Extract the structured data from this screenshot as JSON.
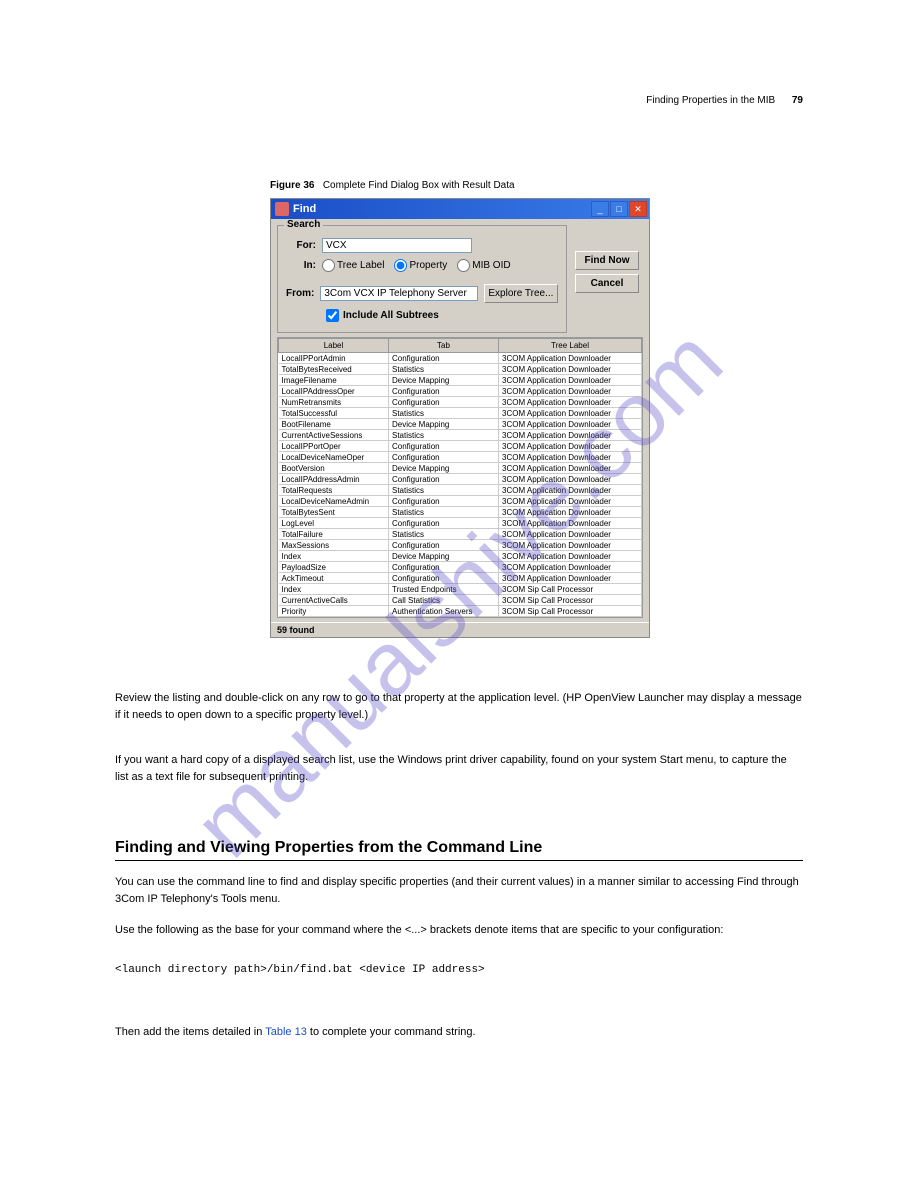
{
  "header": {
    "text": "Finding Properties in the MIB",
    "page": "79"
  },
  "figure": {
    "label": "Figure 36",
    "caption": "Complete Find Dialog Box with Result Data"
  },
  "dialog": {
    "title": "Find",
    "search_legend": "Search",
    "for_label": "For:",
    "for_value": "VCX",
    "in_label": "In:",
    "radio_tree": "Tree Label",
    "radio_property": "Property",
    "radio_miboid": "MIB OID",
    "from_label": "From:",
    "from_value": "3Com VCX IP Telephony Server",
    "explore_button": "Explore Tree...",
    "find_now_button": "Find Now",
    "cancel_button": "Cancel",
    "include_label": "Include All Subtrees",
    "columns": {
      "label": "Label",
      "tab": "Tab",
      "tree": "Tree Label"
    },
    "rows": [
      {
        "label": "LocalIPPortAdmin",
        "tab": "Configuration",
        "tree": "3COM Application Downloader"
      },
      {
        "label": "TotalBytesReceived",
        "tab": "Statistics",
        "tree": "3COM Application Downloader"
      },
      {
        "label": "ImageFilename",
        "tab": "Device Mapping",
        "tree": "3COM Application Downloader"
      },
      {
        "label": "LocalIPAddressOper",
        "tab": "Configuration",
        "tree": "3COM Application Downloader"
      },
      {
        "label": "NumRetransmits",
        "tab": "Configuration",
        "tree": "3COM Application Downloader"
      },
      {
        "label": "TotalSuccessful",
        "tab": "Statistics",
        "tree": "3COM Application Downloader"
      },
      {
        "label": "BootFilename",
        "tab": "Device Mapping",
        "tree": "3COM Application Downloader"
      },
      {
        "label": "CurrentActiveSessions",
        "tab": "Statistics",
        "tree": "3COM Application Downloader"
      },
      {
        "label": "LocalIPPortOper",
        "tab": "Configuration",
        "tree": "3COM Application Downloader"
      },
      {
        "label": "LocalDeviceNameOper",
        "tab": "Configuration",
        "tree": "3COM Application Downloader"
      },
      {
        "label": "BootVersion",
        "tab": "Device Mapping",
        "tree": "3COM Application Downloader"
      },
      {
        "label": "LocalIPAddressAdmin",
        "tab": "Configuration",
        "tree": "3COM Application Downloader"
      },
      {
        "label": "TotalRequests",
        "tab": "Statistics",
        "tree": "3COM Application Downloader"
      },
      {
        "label": "LocalDeviceNameAdmin",
        "tab": "Configuration",
        "tree": "3COM Application Downloader"
      },
      {
        "label": "TotalBytesSent",
        "tab": "Statistics",
        "tree": "3COM Application Downloader"
      },
      {
        "label": "LogLevel",
        "tab": "Configuration",
        "tree": "3COM Application Downloader"
      },
      {
        "label": "TotalFailure",
        "tab": "Statistics",
        "tree": "3COM Application Downloader"
      },
      {
        "label": "MaxSessions",
        "tab": "Configuration",
        "tree": "3COM Application Downloader"
      },
      {
        "label": "Index",
        "tab": "Device Mapping",
        "tree": "3COM Application Downloader"
      },
      {
        "label": "PayloadSize",
        "tab": "Configuration",
        "tree": "3COM Application Downloader"
      },
      {
        "label": "AckTimeout",
        "tab": "Configuration",
        "tree": "3COM Application Downloader"
      },
      {
        "label": "Index",
        "tab": "Trusted Endpoints",
        "tree": "3COM Sip Call Processor"
      },
      {
        "label": "CurrentActiveCalls",
        "tab": "Call Statistics",
        "tree": "3COM Sip Call Processor"
      },
      {
        "label": "Priority",
        "tab": "Authentication Servers",
        "tree": "3COM Sip Call Processor"
      }
    ],
    "status": "59 found"
  },
  "para1": "Review the listing and double-click on any row to go to that property at the application level. (HP OpenView Launcher may display a message if it needs to open down to a specific property level.)",
  "para2": "If you want a hard copy of a displayed search list, use the Windows print driver capability, found on your system Start menu, to capture the list as a text file for subsequent printing.",
  "section_header": "Finding and Viewing Properties from the Command Line",
  "para3": "You can use the command line to find and display specific properties (and their current values) in a manner similar to accessing Find through 3Com IP Telephony's Tools menu.",
  "para4": "Use the following as the base for your command where the <...> brackets denote items that are specific to your configuration:",
  "cmd": "<launch directory path>/bin/find.bat <device IP address>",
  "para6_prefix": "Then add the items detailed in ",
  "para6_link": "Table 13",
  "para6_suffix": " to complete your command string.",
  "watermark": "manualshive.com"
}
